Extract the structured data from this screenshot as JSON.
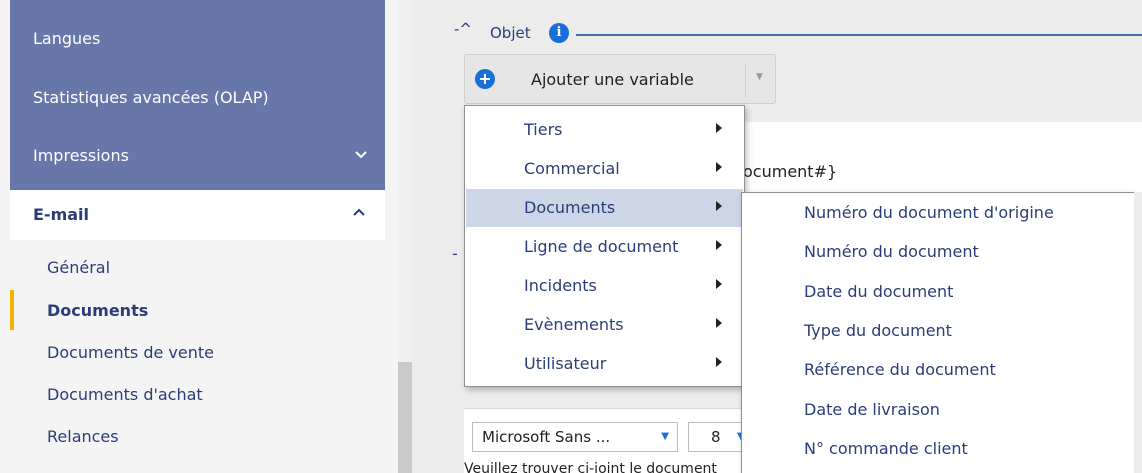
{
  "sidebar": {
    "items": [
      {
        "label": "Langues"
      },
      {
        "label": "Statistiques avancées (OLAP)"
      },
      {
        "label": "Impressions",
        "chevron": "chevron-down-icon"
      }
    ],
    "email": {
      "label": "E-mail",
      "chevron": "chevron-up-icon"
    },
    "email_children": [
      {
        "label": "Général"
      },
      {
        "label": "Documents",
        "active": true
      },
      {
        "label": "Documents de vente"
      },
      {
        "label": "Documents d'achat"
      },
      {
        "label": "Relances"
      }
    ]
  },
  "section": {
    "toggle": "-^",
    "title": "Objet",
    "info_glyph": "i",
    "dash": "-"
  },
  "add_variable": {
    "label": "Ajouter une variable",
    "plus_glyph": "+",
    "caret": "▼"
  },
  "editor": {
    "partial_text": "ocument#}"
  },
  "menu": {
    "items": [
      {
        "label": "Tiers"
      },
      {
        "label": "Commercial"
      },
      {
        "label": "Documents",
        "active": true
      },
      {
        "label": "Ligne de document"
      },
      {
        "label": "Incidents"
      },
      {
        "label": "Evènements"
      },
      {
        "label": "Utilisateur"
      }
    ]
  },
  "submenu": {
    "items": [
      {
        "label": "Numéro du document d'origine"
      },
      {
        "label": "Numéro du document"
      },
      {
        "label": "Date du document"
      },
      {
        "label": "Type du document"
      },
      {
        "label": "Référence du document"
      },
      {
        "label": "Date de livraison"
      },
      {
        "label": "N° commande client"
      }
    ]
  },
  "toolbar": {
    "font_value": "Microsoft Sans ...",
    "size_value": "8",
    "caret": "▼",
    "body_preview": "Veuillez trouver ci-joint le document"
  },
  "colors": {
    "sidebar_accent": "#6777a9",
    "active_marker": "#f5b301",
    "brand_blue": "#1a6fd6",
    "text_navy": "#2b3d78",
    "menu_active": "#cdd6e6"
  }
}
